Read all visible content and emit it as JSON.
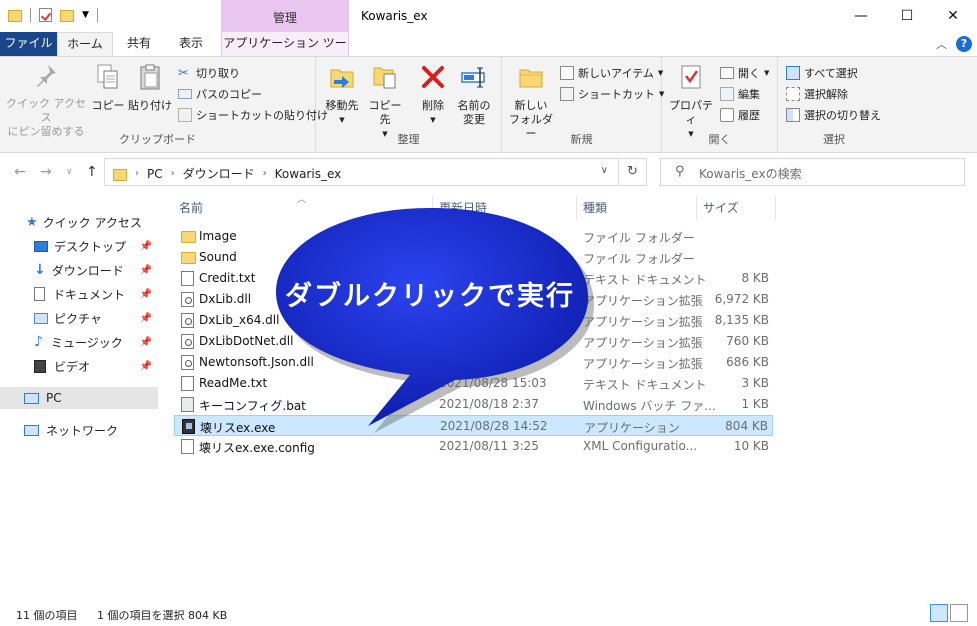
{
  "window": {
    "title": "Kowaris_ex",
    "manage_tab": "管理",
    "controls": {
      "minimize": "—",
      "maximize": "☐",
      "close": "✕"
    }
  },
  "tabs": {
    "file": "ファイル",
    "home": "ホーム",
    "share": "共有",
    "view": "表示",
    "apptool": "アプリケーション ツール"
  },
  "ribbon": {
    "clipboard": {
      "label": "クリップボード",
      "pin": "クイック アクセス\nにピン留めする",
      "pin_line1": "クイック アクセス",
      "pin_line2": "にピン留めする",
      "copy": "コピー",
      "paste": "貼り付け",
      "cut": "切り取り",
      "copy_path": "パスのコピー",
      "paste_shortcut": "ショートカットの貼り付け"
    },
    "organize": {
      "label": "整理",
      "move": "移動先",
      "copyto": "コピー先",
      "delete": "削除",
      "rename_line1": "名前の",
      "rename_line2": "変更"
    },
    "new": {
      "label": "新規",
      "newfolder_line1": "新しい",
      "newfolder_line2": "フォルダー",
      "newitem": "新しいアイテム",
      "shortcut": "ショートカット"
    },
    "open": {
      "label": "開く",
      "properties": "プロパティ",
      "open": "開く",
      "edit": "編集",
      "history": "履歴"
    },
    "select": {
      "label": "選択",
      "all": "すべて選択",
      "none": "選択解除",
      "invert": "選択の切り替え"
    }
  },
  "address": {
    "crumbs": [
      "PC",
      "ダウンロード",
      "Kowaris_ex"
    ],
    "search_placeholder": "Kowaris_exの検索"
  },
  "nav": {
    "quick_access": "クイック アクセス",
    "items": [
      {
        "label": "デスクトップ",
        "icon": "desktop-icon"
      },
      {
        "label": "ダウンロード",
        "icon": "download-icon"
      },
      {
        "label": "ドキュメント",
        "icon": "document-icon"
      },
      {
        "label": "ピクチャ",
        "icon": "picture-icon"
      },
      {
        "label": "ミュージック",
        "icon": "music-icon"
      },
      {
        "label": "ビデオ",
        "icon": "video-icon"
      }
    ],
    "pc": "PC",
    "network": "ネットワーク"
  },
  "columns": {
    "name": "名前",
    "date": "更新日時",
    "type": "種類",
    "size": "サイズ"
  },
  "files": [
    {
      "name": "Image",
      "date": "",
      "type": "ファイル フォルダー",
      "size": "",
      "kind": "folder"
    },
    {
      "name": "Sound",
      "date": "",
      "type": "ファイル フォルダー",
      "size": "",
      "kind": "folder"
    },
    {
      "name": "Credit.txt",
      "date": "",
      "type": "テキスト ドキュメント",
      "size": "8 KB",
      "kind": "doc"
    },
    {
      "name": "DxLib.dll",
      "date": "",
      "type": "アプリケーション拡張",
      "size": "6,972 KB",
      "kind": "dll"
    },
    {
      "name": "DxLib_x64.dll",
      "date": "",
      "type": "アプリケーション拡張",
      "size": "8,135 KB",
      "kind": "dll"
    },
    {
      "name": "DxLibDotNet.dll",
      "date": "",
      "type": "アプリケーション拡張",
      "size": "760 KB",
      "kind": "dll"
    },
    {
      "name": "Newtonsoft.Json.dll",
      "date": "",
      "type": "アプリケーション拡張",
      "size": "686 KB",
      "kind": "dll"
    },
    {
      "name": "ReadMe.txt",
      "date": "2021/08/28 15:03",
      "type": "テキスト ドキュメント",
      "size": "3 KB",
      "kind": "doc"
    },
    {
      "name": "キーコンフィグ.bat",
      "date": "2021/08/18 2:37",
      "type": "Windows バッチ ファ...",
      "size": "1 KB",
      "kind": "bat"
    },
    {
      "name": "壊リスex.exe",
      "date": "2021/08/28 14:52",
      "type": "アプリケーション",
      "size": "804 KB",
      "kind": "exe",
      "selected": true
    },
    {
      "name": "壊リスex.exe.config",
      "date": "2021/08/11 3:25",
      "type": "XML Configuratio...",
      "size": "10 KB",
      "kind": "cfg"
    }
  ],
  "status": {
    "count": "11 個の項目",
    "selection": "1 個の項目を選択  804 KB"
  },
  "callout": {
    "text": "ダブルクリックで実行"
  },
  "colors": {
    "file_tab": "#19478a",
    "manage": "#e8c6ef",
    "selected_row": "#cce8ff",
    "bubble": "#1a2fd6"
  }
}
